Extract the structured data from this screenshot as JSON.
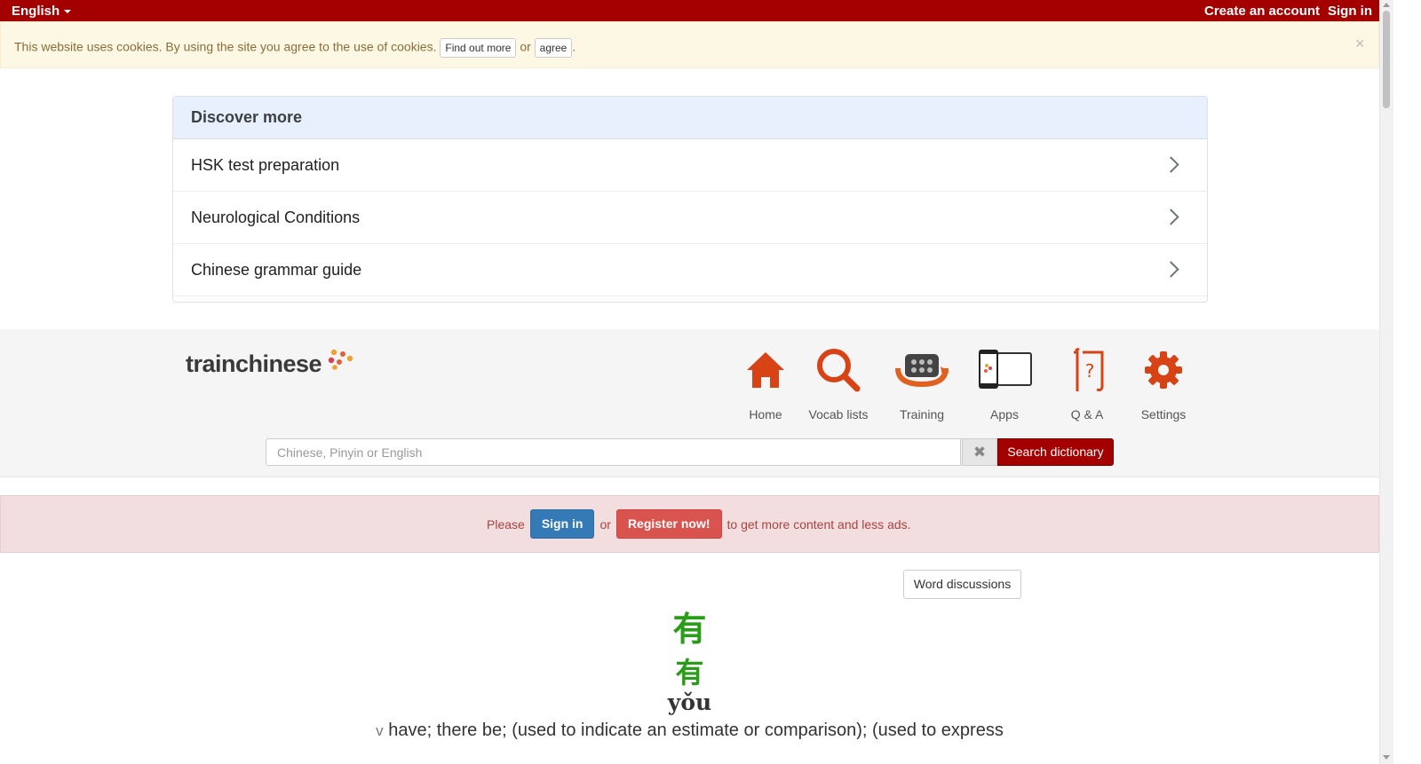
{
  "topbar": {
    "language": "English",
    "create_account": "Create an account",
    "sign_in": "Sign in"
  },
  "cookie": {
    "message": "This website uses cookies. By using the site you agree to the use of cookies.",
    "find_out_more": "Find out more",
    "or": "or",
    "agree": "agree",
    "period": ".",
    "close": "×"
  },
  "discover": {
    "title": "Discover more",
    "items": [
      {
        "label": "HSK test preparation"
      },
      {
        "label": "Neurological Conditions"
      },
      {
        "label": "Chinese grammar guide"
      }
    ]
  },
  "brand": {
    "logo_text": "trainchinese"
  },
  "nav": {
    "home": "Home",
    "vocab": "Vocab lists",
    "training": "Training",
    "apps": "Apps",
    "qa": "Q & A",
    "settings": "Settings",
    "icon_color": "#d84315"
  },
  "search": {
    "placeholder": "Chinese, Pinyin or English",
    "clear": "✖",
    "button": "Search dictionary"
  },
  "alert": {
    "please": "Please",
    "sign_in": "Sign in",
    "or": "or",
    "register": "Register now!",
    "suffix": "to get more content and less ads."
  },
  "word": {
    "discussions_button": "Word discussions",
    "simplified": "有",
    "traditional": "有",
    "pinyin": "yǒu",
    "pos": "v",
    "definition": "have; there be; (used to indicate an estimate or comparison); (used to express"
  },
  "colors": {
    "brand_red": "#a50000",
    "chinese_green": "#2a9d18",
    "primary_blue": "#337ab7",
    "danger_red": "#d9534f"
  }
}
